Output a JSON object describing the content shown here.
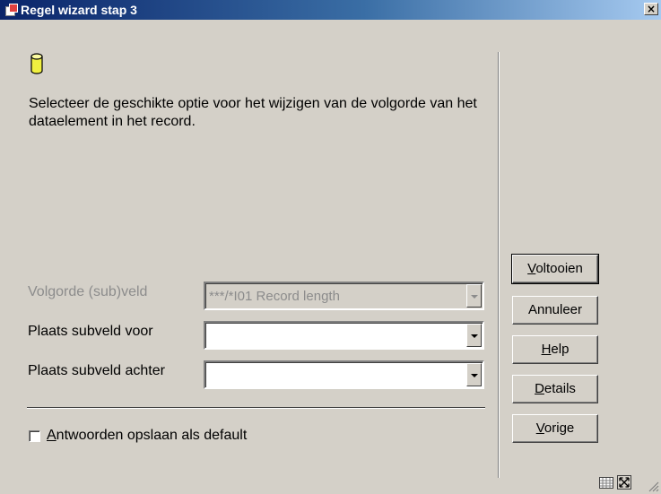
{
  "window": {
    "title": "Regel wizard stap 3",
    "close_symbol": "×",
    "app_icon": "app-icon"
  },
  "main": {
    "icon": "database-icon",
    "instruction": "Selecteer de geschikte optie voor het wijzigen van de volgorde van het dataelement in het record."
  },
  "form": {
    "volgorde_label": "Volgorde (sub)veld",
    "volgorde_value": "***/*I01 Record length",
    "voor_label": "Plaats subveld voor",
    "voor_value": "",
    "achter_label": "Plaats subveld achter",
    "achter_value": ""
  },
  "checkbox": {
    "mnemonic": "A",
    "label_rest": "ntwoorden opslaan als default",
    "checked": false
  },
  "buttons": {
    "voltooien": {
      "mnemonic": "V",
      "rest": "oltooien"
    },
    "annuleer": {
      "label": "Annuleer"
    },
    "help": {
      "mnemonic": "H",
      "rest": "elp"
    },
    "details": {
      "mnemonic": "D",
      "rest": "etails"
    },
    "vorige": {
      "mnemonic": "V",
      "rest": "orige"
    }
  },
  "colors": {
    "window_bg": "#d4d0c8",
    "title_start": "#0a246a",
    "title_end": "#a6caf0",
    "disabled_text": "#8c8c8c",
    "db_icon_fill": "#f0f040"
  }
}
